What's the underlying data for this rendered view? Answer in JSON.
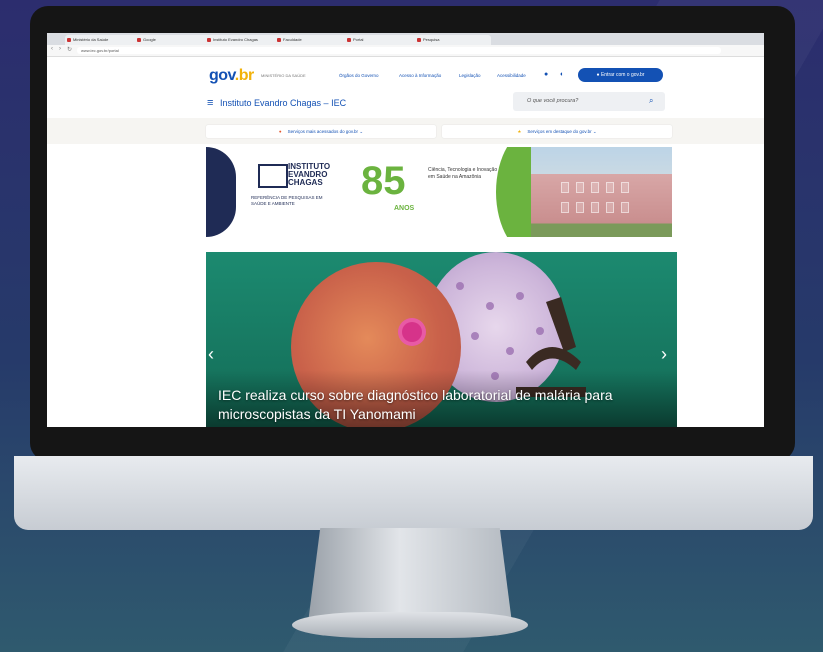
{
  "browser": {
    "tabs": [
      "Ministério da Saúde",
      "Google",
      "Instituto Evandro Chagas",
      "Faculdade",
      "Portal",
      "Pesquisa"
    ],
    "url": "www.iec.gov.br/portal"
  },
  "header": {
    "logo_main": "gov",
    "logo_accent": ".br",
    "logo_sub": "MINISTÉRIO DA SAÚDE",
    "links": [
      "Órgãos do Governo",
      "Acesso à Informação",
      "Legislação",
      "Acessibilidade"
    ],
    "login_label": "Entrar com o gov.br",
    "site_title": "Instituto Evandro Chagas – IEC",
    "search_placeholder": "O que você procura?"
  },
  "dropdowns": [
    {
      "label": "Serviços mais acessados do gov.br"
    },
    {
      "label": "Serviços em destaque do gov.br"
    }
  ],
  "banner": {
    "inst_name": "INSTITUTO EVANDRO CHAGAS",
    "inst_sub": "REFERÊNCIA DE PESQUISAS EM SAÚDE E AMBIENTE",
    "anos_number": "85",
    "anos_label": "ANOS",
    "anos_text": "Ciência, Tecnologia e Inovação em Saúde na Amazônia"
  },
  "hero": {
    "caption": "IEC realiza curso sobre diagnóstico laboratorial de malária para microscopistas da TI Yanomami",
    "prev": "‹",
    "next": "›"
  },
  "colors": {
    "gov_blue": "#1351b4",
    "gov_yellow": "#f2b20a",
    "iec_green": "#6bb33f",
    "hero_green": "#1c8a70"
  }
}
